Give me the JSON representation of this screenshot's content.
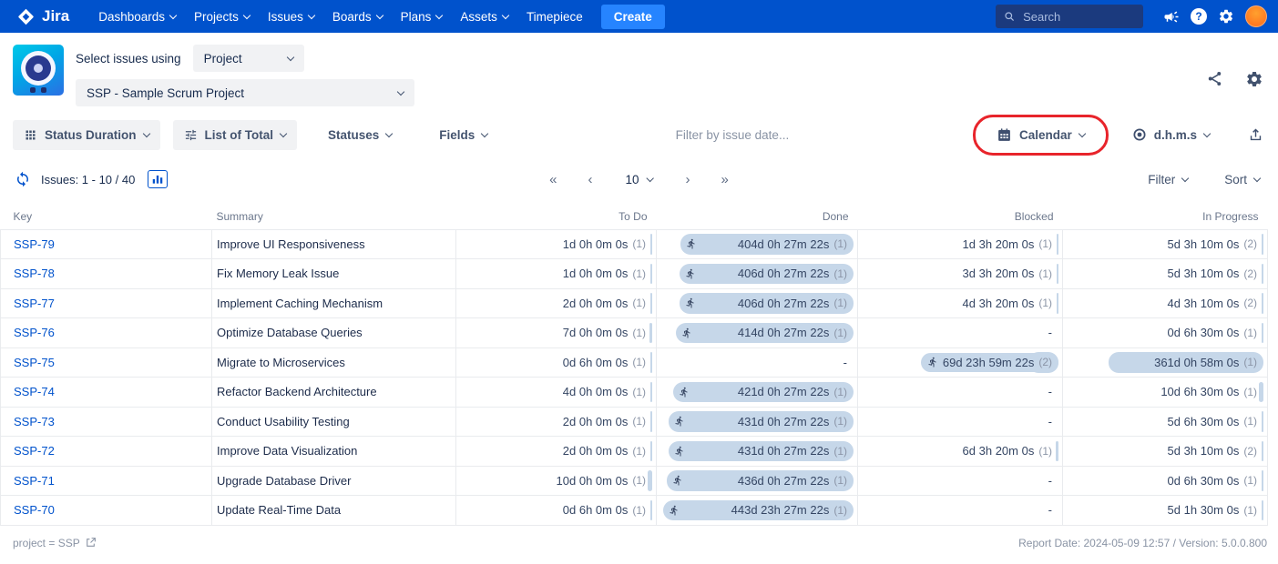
{
  "colors": {
    "navbar": "#0052CC",
    "accent": "#0052CC",
    "create_button": "#2684FF",
    "pill": "#C6D7E9",
    "annotation": "#E8242B",
    "avatar": "#FF7A22",
    "link": "#0052CC"
  },
  "topnav": {
    "brand": "Jira",
    "items": [
      {
        "label": "Dashboards",
        "chevron": true
      },
      {
        "label": "Projects",
        "chevron": true
      },
      {
        "label": "Issues",
        "chevron": true
      },
      {
        "label": "Boards",
        "chevron": true
      },
      {
        "label": "Plans",
        "chevron": true
      },
      {
        "label": "Assets",
        "chevron": true
      },
      {
        "label": "Timepiece",
        "chevron": false
      }
    ],
    "create_label": "Create",
    "search_placeholder": "Search",
    "help_glyph": "?"
  },
  "header": {
    "select_label": "Select issues using",
    "select_value": "Project",
    "project_value": "SSP - Sample Scrum Project"
  },
  "toolbar": {
    "status_duration": "Status Duration",
    "list_of_total": "List of Total",
    "statuses": "Statuses",
    "fields": "Fields",
    "date_filter_placeholder": "Filter by issue date...",
    "calendar_label": "Calendar",
    "format_label": "d.h.m.s"
  },
  "pagination": {
    "issues_label": "Issues: 1 - 10 / 40",
    "first": "«",
    "prev": "‹",
    "page_size": "10",
    "next": "›",
    "last": "»",
    "filter_label": "Filter",
    "sort_label": "Sort"
  },
  "table": {
    "columns": [
      "Key",
      "Summary",
      "To Do",
      "Done",
      "Blocked",
      "In Progress"
    ],
    "rows": [
      {
        "key": "SSP-79",
        "summary": "Improve UI Responsiveness",
        "todo": {
          "text": "1d 0h 0m 0s",
          "count": "(1)",
          "days": 1
        },
        "done": {
          "text": "404d 0h 27m 22s",
          "count": "(1)",
          "days": 404,
          "runner": true
        },
        "blocked": {
          "text": "1d 3h 20m 0s",
          "count": "(1)",
          "days": 1.14
        },
        "inprogress": {
          "text": "5d 3h 10m 0s",
          "count": "(2)",
          "days": 5.13
        }
      },
      {
        "key": "SSP-78",
        "summary": "Fix Memory Leak Issue",
        "todo": {
          "text": "1d 0h 0m 0s",
          "count": "(1)",
          "days": 1
        },
        "done": {
          "text": "406d 0h 27m 22s",
          "count": "(1)",
          "days": 406,
          "runner": true
        },
        "blocked": {
          "text": "3d 3h 20m 0s",
          "count": "(1)",
          "days": 3.14
        },
        "inprogress": {
          "text": "5d 3h 10m 0s",
          "count": "(2)",
          "days": 5.13
        }
      },
      {
        "key": "SSP-77",
        "summary": "Implement Caching Mechanism",
        "todo": {
          "text": "2d 0h 0m 0s",
          "count": "(1)",
          "days": 2
        },
        "done": {
          "text": "406d 0h 27m 22s",
          "count": "(1)",
          "days": 406,
          "runner": true
        },
        "blocked": {
          "text": "4d 3h 20m 0s",
          "count": "(1)",
          "days": 4.14
        },
        "inprogress": {
          "text": "4d 3h 10m 0s",
          "count": "(2)",
          "days": 4.13
        }
      },
      {
        "key": "SSP-76",
        "summary": "Optimize Database Queries",
        "todo": {
          "text": "7d 0h 0m 0s",
          "count": "(1)",
          "days": 7
        },
        "done": {
          "text": "414d 0h 27m 22s",
          "count": "(1)",
          "days": 414,
          "runner": true
        },
        "blocked": {
          "text": "-"
        },
        "inprogress": {
          "text": "0d 6h 30m 0s",
          "count": "(1)",
          "days": 0.27
        }
      },
      {
        "key": "SSP-75",
        "summary": "Migrate to Microservices",
        "todo": {
          "text": "0d 6h 0m 0s",
          "count": "(1)",
          "days": 0.25
        },
        "done": {
          "text": "-"
        },
        "blocked": {
          "text": "69d 23h 59m 22s",
          "count": "(2)",
          "days": 70,
          "runner": true
        },
        "inprogress": {
          "text": "361d 0h 58m 0s",
          "count": "(1)",
          "days": 361
        }
      },
      {
        "key": "SSP-74",
        "summary": "Refactor Backend Architecture",
        "todo": {
          "text": "4d 0h 0m 0s",
          "count": "(1)",
          "days": 4
        },
        "done": {
          "text": "421d 0h 27m 22s",
          "count": "(1)",
          "days": 421,
          "runner": true
        },
        "blocked": {
          "text": "-"
        },
        "inprogress": {
          "text": "10d 6h 30m 0s",
          "count": "(1)",
          "days": 10.27
        }
      },
      {
        "key": "SSP-73",
        "summary": "Conduct Usability Testing",
        "todo": {
          "text": "2d 0h 0m 0s",
          "count": "(1)",
          "days": 2
        },
        "done": {
          "text": "431d 0h 27m 22s",
          "count": "(1)",
          "days": 431,
          "runner": true
        },
        "blocked": {
          "text": "-"
        },
        "inprogress": {
          "text": "5d 6h 30m 0s",
          "count": "(1)",
          "days": 5.27
        }
      },
      {
        "key": "SSP-72",
        "summary": "Improve Data Visualization",
        "todo": {
          "text": "2d 0h 0m 0s",
          "count": "(1)",
          "days": 2
        },
        "done": {
          "text": "431d 0h 27m 22s",
          "count": "(1)",
          "days": 431,
          "runner": true
        },
        "blocked": {
          "text": "6d 3h 20m 0s",
          "count": "(1)",
          "days": 6.14
        },
        "inprogress": {
          "text": "5d 3h 10m 0s",
          "count": "(2)",
          "days": 5.13
        }
      },
      {
        "key": "SSP-71",
        "summary": "Upgrade Database Driver",
        "todo": {
          "text": "10d 0h 0m 0s",
          "count": "(1)",
          "days": 10
        },
        "done": {
          "text": "436d 0h 27m 22s",
          "count": "(1)",
          "days": 436,
          "runner": true
        },
        "blocked": {
          "text": "-"
        },
        "inprogress": {
          "text": "0d 6h 30m 0s",
          "count": "(1)",
          "days": 0.27
        }
      },
      {
        "key": "SSP-70",
        "summary": "Update Real-Time Data",
        "todo": {
          "text": "0d 6h 0m 0s",
          "count": "(1)",
          "days": 0.25
        },
        "done": {
          "text": "443d 23h 27m 22s",
          "count": "(1)",
          "days": 443.98,
          "runner": true
        },
        "blocked": {
          "text": "-"
        },
        "inprogress": {
          "text": "5d 1h 30m 0s",
          "count": "(1)",
          "days": 5.06
        }
      }
    ]
  },
  "footer": {
    "query": "project = SSP",
    "report_info": "Report Date: 2024-05-09 12:57 / Version: 5.0.0.800"
  }
}
